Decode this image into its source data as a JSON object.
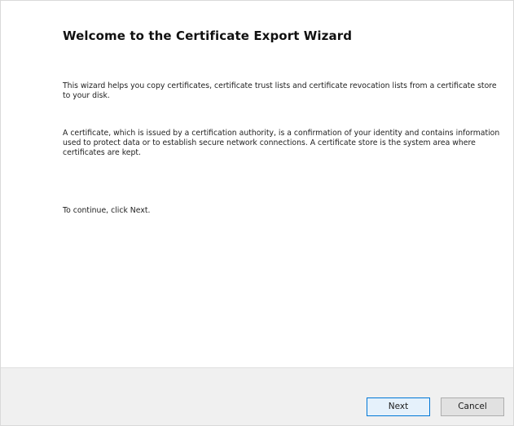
{
  "wizard": {
    "title": "Welcome to the Certificate Export Wizard",
    "paragraphs": [
      "This wizard helps you copy certificates, certificate trust lists and certificate revocation lists from a certificate store to your disk.",
      "A certificate, which is issued by a certification authority, is a confirmation of your identity and contains information used to protect data or to establish secure network connections. A certificate store is the system area where certificates are kept.",
      "To continue, click Next."
    ]
  },
  "footer": {
    "next_label": "Next",
    "cancel_label": "Cancel"
  },
  "colors": {
    "background": "#ffffff",
    "footer_background": "#f0f0f0",
    "default_button_border": "#0078d7"
  }
}
